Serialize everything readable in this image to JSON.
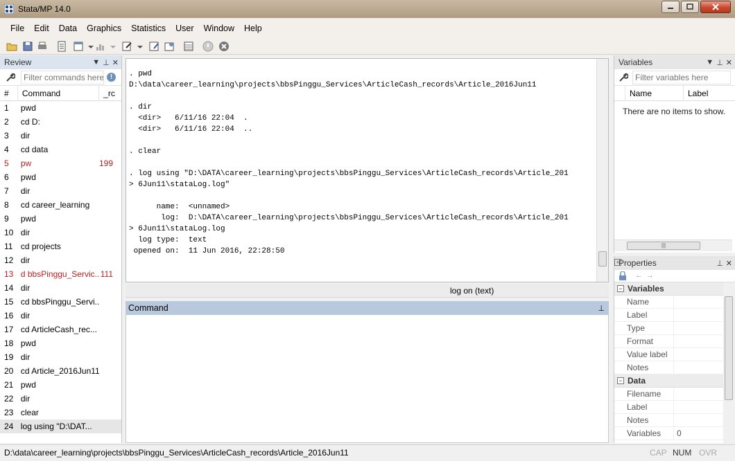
{
  "window": {
    "title": "Stata/MP 14.0"
  },
  "menubar": [
    "File",
    "Edit",
    "Data",
    "Graphics",
    "Statistics",
    "User",
    "Window",
    "Help"
  ],
  "review": {
    "title": "Review",
    "filter_placeholder": "Filter commands here",
    "col_num": "#",
    "col_command": "Command",
    "col_rc": "_rc",
    "rows": [
      {
        "n": "1",
        "cmd": "pwd",
        "rc": ""
      },
      {
        "n": "2",
        "cmd": "cd D:",
        "rc": ""
      },
      {
        "n": "3",
        "cmd": "dir",
        "rc": ""
      },
      {
        "n": "4",
        "cmd": "cd data",
        "rc": ""
      },
      {
        "n": "5",
        "cmd": "pw",
        "rc": "199"
      },
      {
        "n": "6",
        "cmd": "pwd",
        "rc": ""
      },
      {
        "n": "7",
        "cmd": "dir",
        "rc": ""
      },
      {
        "n": "8",
        "cmd": "cd career_learning",
        "rc": ""
      },
      {
        "n": "9",
        "cmd": "pwd",
        "rc": ""
      },
      {
        "n": "10",
        "cmd": "dir",
        "rc": ""
      },
      {
        "n": "11",
        "cmd": "cd projects",
        "rc": ""
      },
      {
        "n": "12",
        "cmd": "dir",
        "rc": ""
      },
      {
        "n": "13",
        "cmd": "d bbsPinggu_Servic...",
        "rc": "111"
      },
      {
        "n": "14",
        "cmd": "dir",
        "rc": ""
      },
      {
        "n": "15",
        "cmd": "cd bbsPinggu_Servi...",
        "rc": ""
      },
      {
        "n": "16",
        "cmd": "dir",
        "rc": ""
      },
      {
        "n": "17",
        "cmd": "cd ArticleCash_rec...",
        "rc": ""
      },
      {
        "n": "18",
        "cmd": "pwd",
        "rc": ""
      },
      {
        "n": "19",
        "cmd": "dir",
        "rc": ""
      },
      {
        "n": "20",
        "cmd": "cd Article_2016Jun11",
        "rc": ""
      },
      {
        "n": "21",
        "cmd": "pwd",
        "rc": ""
      },
      {
        "n": "22",
        "cmd": "dir",
        "rc": ""
      },
      {
        "n": "23",
        "cmd": "clear",
        "rc": ""
      },
      {
        "n": "24",
        "cmd": "log using \"D:\\DAT...",
        "rc": ""
      }
    ]
  },
  "results": {
    "text": ". pwd\nD:\\data\\career_learning\\projects\\bbsPinggu_Services\\ArticleCash_records\\Article_2016Jun11\n\n. dir\n  <dir>   6/11/16 22:04  .\n  <dir>   6/11/16 22:04  ..\n\n. clear\n\n. log using \"D:\\DATA\\career_learning\\projects\\bbsPinggu_Services\\ArticleCash_records\\Article_201\n> 6Jun11\\stataLog.log\"\n\n      name:  <unnamed>\n       log:  D:\\DATA\\career_learning\\projects\\bbsPinggu_Services\\ArticleCash_records\\Article_201\n> 6Jun11\\stataLog.log\n  log type:  text\n opened on:  11 Jun 2016, 22:28:50\n\n\n.",
    "status": "log on (text)"
  },
  "command": {
    "title": "Command"
  },
  "variables": {
    "title": "Variables",
    "filter_placeholder": "Filter variables here",
    "col_name": "Name",
    "col_label": "Label",
    "empty": "There are no items to show."
  },
  "properties": {
    "title": "Properties",
    "sections": [
      {
        "name": "Variables",
        "rows": [
          {
            "k": "Name",
            "v": ""
          },
          {
            "k": "Label",
            "v": ""
          },
          {
            "k": "Type",
            "v": ""
          },
          {
            "k": "Format",
            "v": ""
          },
          {
            "k": "Value label",
            "v": ""
          },
          {
            "k": "Notes",
            "v": ""
          }
        ]
      },
      {
        "name": "Data",
        "rows": [
          {
            "k": "Filename",
            "v": ""
          },
          {
            "k": "Label",
            "v": ""
          },
          {
            "k": "Notes",
            "v": ""
          },
          {
            "k": "Variables",
            "v": "0"
          }
        ]
      }
    ]
  },
  "statusbar": {
    "path": "D:\\data\\career_learning\\projects\\bbsPinggu_Services\\ArticleCash_records\\Article_2016Jun11",
    "cap": "CAP",
    "num": "NUM",
    "ovr": "OVR"
  },
  "colors": {
    "error": "#b82020",
    "command_header": "#b9c9dd",
    "review_header": "#dbe4ef"
  }
}
